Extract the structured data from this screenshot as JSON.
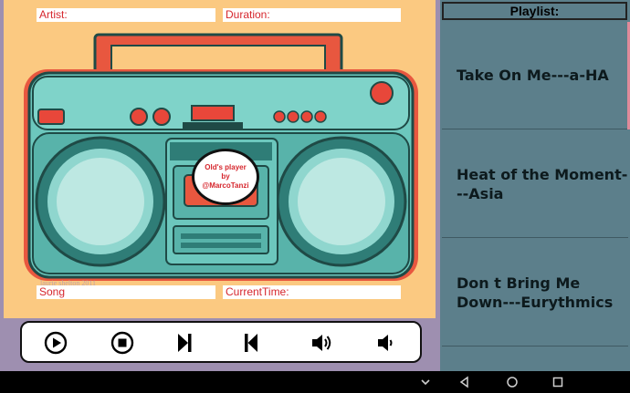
{
  "fields": {
    "artist_label": "Artist:",
    "duration_label": "Duration:",
    "song_label": "Song",
    "current_time_label": "CurrentTime:"
  },
  "badge": {
    "line1": "Old's player",
    "line2": "by",
    "line3": "@MarcoTanzi"
  },
  "artwork": {
    "credit": "laurie shelton 2011"
  },
  "controls": {
    "icons": [
      "play-icon",
      "stop-icon",
      "skip-next-icon",
      "skip-previous-icon",
      "volume-up-icon",
      "volume-down-icon"
    ]
  },
  "playlist": {
    "title": "Playlist:",
    "tracks": [
      {
        "label": "Take On Me---a-HA"
      },
      {
        "label": "Heat of the Moment---Asia"
      },
      {
        "label": "Don t Bring Me Down---Eurythmics"
      }
    ]
  },
  "colors": {
    "stage_bg": "#fbc981",
    "playlist_bg": "#5c7f8b",
    "accent_red": "#d6262d",
    "boombox_teal": "#6cc7bd",
    "frame": "#9e8fb0"
  },
  "navbar": {
    "icons": [
      "hide-keyboard-icon",
      "back-icon",
      "home-icon",
      "recents-icon"
    ]
  }
}
